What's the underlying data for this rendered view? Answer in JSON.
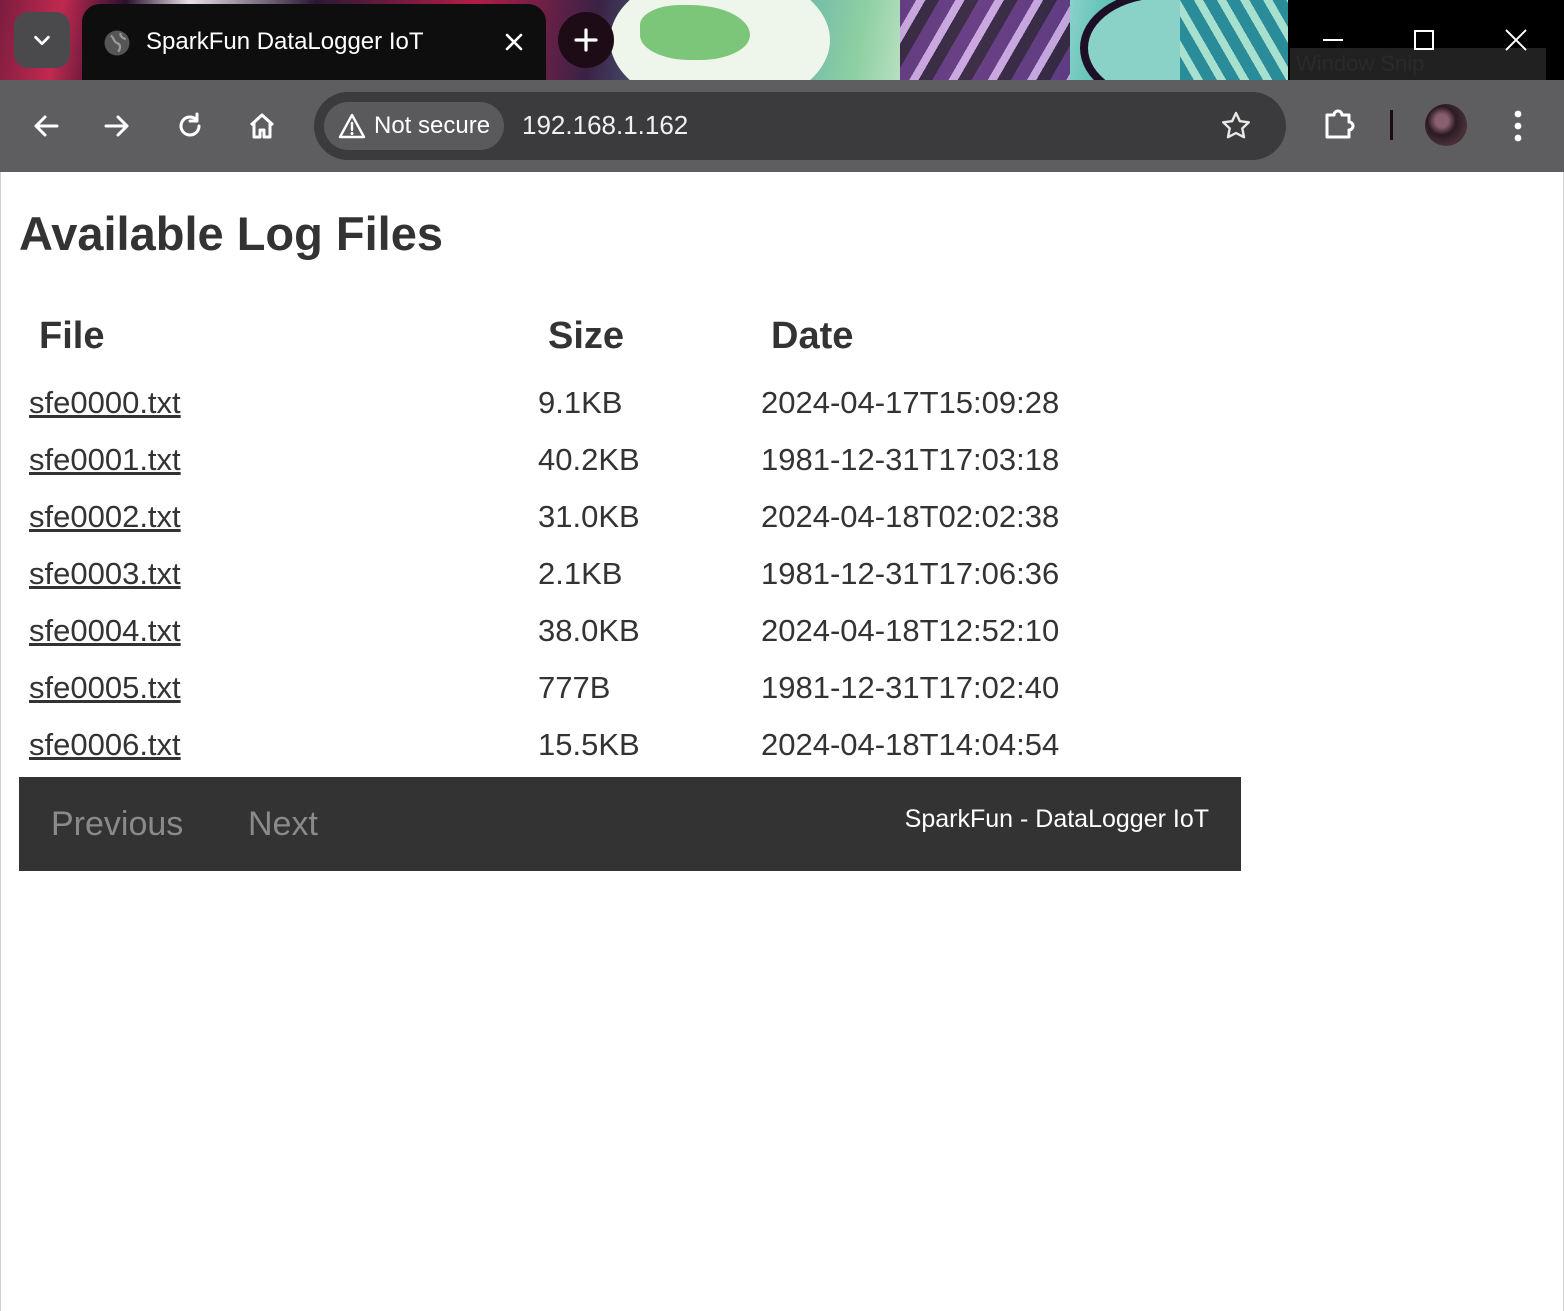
{
  "browser": {
    "tab_title": "SparkFun DataLogger IoT",
    "security_label": "Not secure",
    "url": "192.168.1.162",
    "snip_label": "Window Snip"
  },
  "page": {
    "title": "Available Log Files",
    "columns": [
      "File",
      "Size",
      "Date"
    ],
    "files": [
      {
        "name": "sfe0000.txt",
        "size": "9.1KB",
        "date": "2024-04-17T15:09:28"
      },
      {
        "name": "sfe0001.txt",
        "size": "40.2KB",
        "date": "1981-12-31T17:03:18"
      },
      {
        "name": "sfe0002.txt",
        "size": "31.0KB",
        "date": "2024-04-18T02:02:38"
      },
      {
        "name": "sfe0003.txt",
        "size": "2.1KB",
        "date": "1981-12-31T17:06:36"
      },
      {
        "name": "sfe0004.txt",
        "size": "38.0KB",
        "date": "2024-04-18T12:52:10"
      },
      {
        "name": "sfe0005.txt",
        "size": "777B",
        "date": "1981-12-31T17:02:40"
      },
      {
        "name": "sfe0006.txt",
        "size": "15.5KB",
        "date": "2024-04-18T14:04:54"
      }
    ],
    "footer": {
      "previous_label": "Previous",
      "next_label": "Next",
      "brand": "SparkFun - DataLogger IoT"
    }
  },
  "icons": {
    "tab_search": "chevron-down-icon",
    "favicon": "globe-icon",
    "tab_close": "close-icon",
    "new_tab": "plus-icon",
    "minimize": "minimize-icon",
    "maximize": "maximize-icon",
    "window_close": "close-icon",
    "back": "arrow-left-icon",
    "forward": "arrow-right-icon",
    "reload": "reload-icon",
    "home": "home-icon",
    "warning": "warning-icon",
    "bookmark": "star-icon",
    "extensions": "puzzle-icon",
    "menu": "kebab-icon"
  },
  "colors": {
    "page_text": "#333333",
    "footer_bg": "#333333",
    "footer_link": "#8a8a8a",
    "toolbar_bg": "#5e5e60"
  }
}
